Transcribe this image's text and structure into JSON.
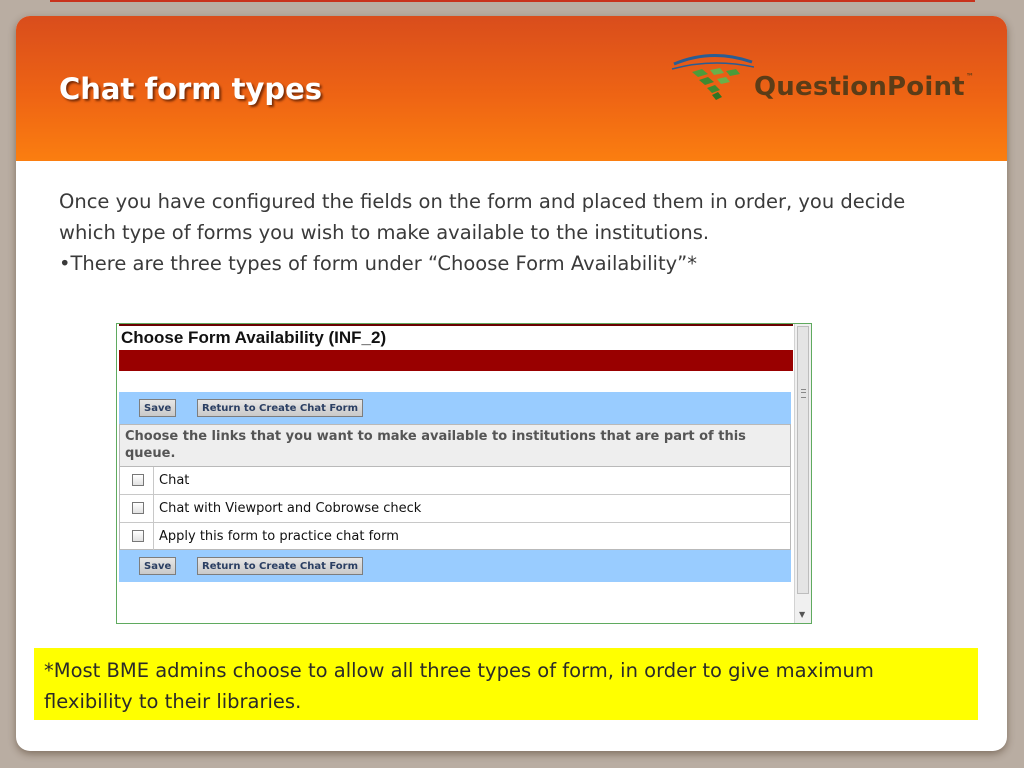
{
  "slide": {
    "title": "Chat form types",
    "logo": {
      "text": "QuestionPoint",
      "trademark": "™"
    },
    "body": {
      "paragraph": "Once you have configured the fields on the form and placed them in order, you decide which type of forms you wish to make available to the institutions.",
      "bullet": "•There are three types of form under “Choose Form Availability”*"
    },
    "note": "*Most BME admins choose to allow all three types of form, in order to give maximum flexibility to their libraries."
  },
  "screenshot": {
    "title": "Choose Form Availability (INF_2)",
    "buttons": {
      "save": "Save",
      "return": "Return to Create Chat Form"
    },
    "instruction": "Choose the links that you want to make available to institutions that are part of this queue.",
    "options": [
      {
        "label": "Chat",
        "checked": false
      },
      {
        "label": "Chat with Viewport and Cobrowse check",
        "checked": false
      },
      {
        "label": "Apply this form to practice chat form",
        "checked": false
      }
    ]
  },
  "colors": {
    "header_orange": "#ee6414",
    "brand_brown": "#5b3c17",
    "dark_red_bar": "#990000",
    "button_bar_blue": "#99ccff",
    "highlight_yellow": "#ffff00"
  },
  "icons": [
    "questionpoint-logo-icon",
    "checkbox",
    "scroll-down-arrow-icon"
  ]
}
